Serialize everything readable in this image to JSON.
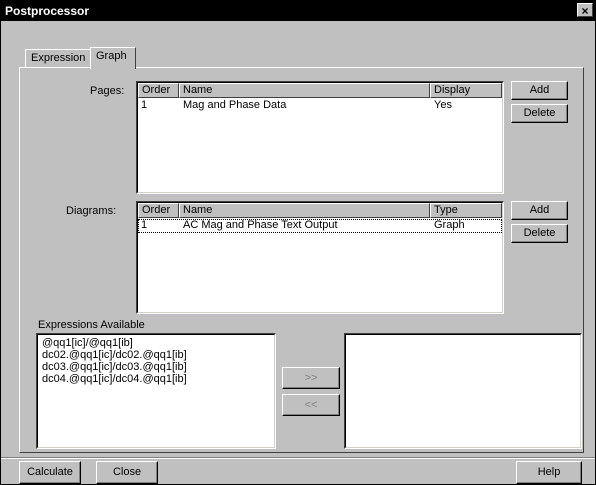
{
  "window": {
    "title": "Postprocessor",
    "close_glyph": "×"
  },
  "tabs": [
    {
      "label": "Expression"
    },
    {
      "label": "Graph"
    }
  ],
  "pages": {
    "label": "Pages:",
    "columns": [
      "Order",
      "Name",
      "Display"
    ],
    "rows": [
      {
        "order": "1",
        "name": "Mag and Phase Data",
        "display": "Yes"
      }
    ],
    "add_label": "Add",
    "delete_label": "Delete"
  },
  "diagrams": {
    "label": "Diagrams:",
    "columns": [
      "Order",
      "Name",
      "Type"
    ],
    "rows": [
      {
        "order": "1",
        "name": "AC Mag and Phase Text Output",
        "type": "Graph"
      }
    ],
    "add_label": "Add",
    "delete_label": "Delete"
  },
  "expressions": {
    "label": "Expressions Available",
    "items": [
      "@qq1[ic]/@qq1[ib]",
      "dc02.@qq1[ic]/dc02.@qq1[ib]",
      "dc03.@qq1[ic]/dc03.@qq1[ib]",
      "dc04.@qq1[ic]/dc04.@qq1[ib]"
    ],
    "move_right_label": ">>",
    "move_left_label": "<<"
  },
  "footer": {
    "calculate_label": "Calculate",
    "close_label": "Close",
    "help_label": "Help"
  }
}
